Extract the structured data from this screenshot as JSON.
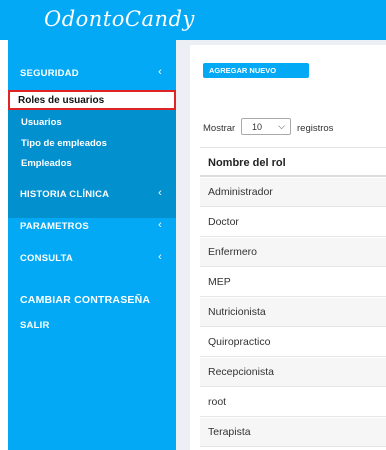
{
  "app": {
    "logo": "OdontoCandy"
  },
  "sidebar": {
    "security": {
      "label": "SEGURIDAD",
      "chevron": "‹"
    },
    "submenu": [
      "Roles de usuarios",
      "Usuarios",
      "Tipo de empleados",
      "Empleados"
    ],
    "clinical_history": {
      "label": "HISTORIA CLÍNICA",
      "chevron": "‹"
    },
    "parameters": {
      "label": "PARAMETROS",
      "chevron": "‹"
    },
    "consultation": {
      "label": "CONSULTA",
      "chevron": "‹"
    },
    "change_password": {
      "label": "CAMBIAR CONTRASEÑA"
    },
    "logout": {
      "label": "SALIR"
    }
  },
  "main": {
    "add_button": "AGREGAR NUEVO",
    "show_label": "Mostrar",
    "page_size": "10",
    "records_label": "registros",
    "table": {
      "header": "Nombre del rol",
      "rows": [
        "Administrador",
        "Doctor",
        "Enfermero",
        "MEP",
        "Nutricionista",
        "Quiropractico",
        "Recepcionista",
        "root",
        "Terapista"
      ]
    }
  },
  "colors": {
    "primary": "#03a9f4",
    "submenu_bg": "#0290cf",
    "highlight_border": "#e02424"
  }
}
